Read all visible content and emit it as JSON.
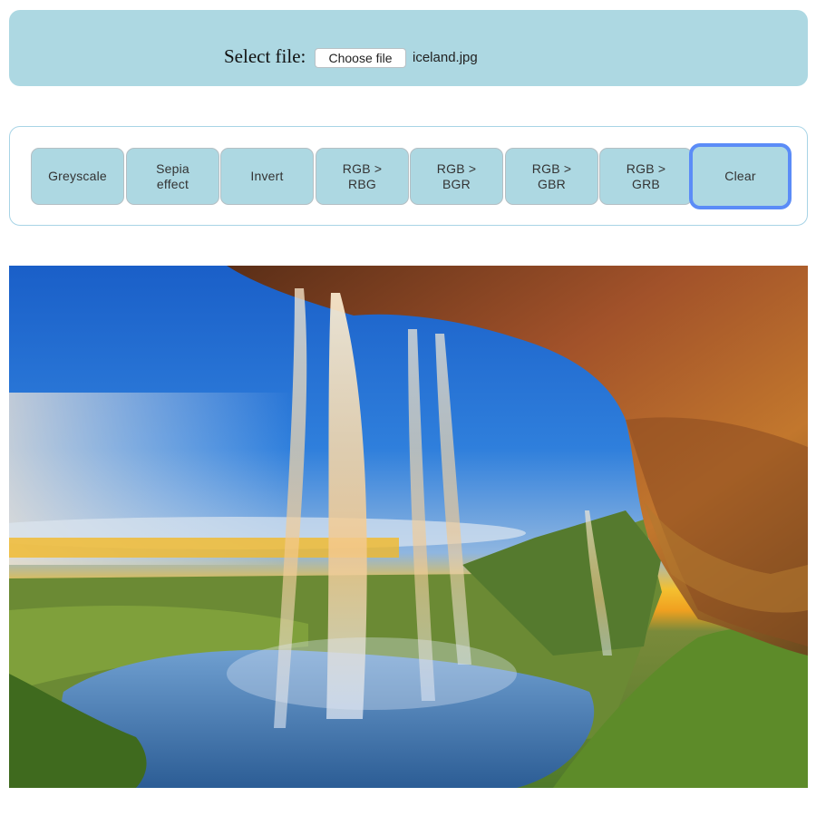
{
  "file_panel": {
    "label": "Select file:",
    "choose_button": "Choose file",
    "file_name": "iceland.jpg"
  },
  "toolbar": {
    "buttons": [
      {
        "label": "Greyscale"
      },
      {
        "label": "Sepia\neffect"
      },
      {
        "label": "Invert"
      },
      {
        "label": "RGB >\nRBG"
      },
      {
        "label": "RGB >\nBGR"
      },
      {
        "label": "RGB >\nGBR"
      },
      {
        "label": "RGB >\nGRB"
      },
      {
        "label": "Clear"
      }
    ],
    "focused_button": "Clear"
  },
  "image": {
    "subject": "waterfall-cave-landscape"
  },
  "colors": {
    "panel_bg": "#add8e2",
    "button_bg": "#add8e2",
    "focus_ring": "#5b8cf7"
  }
}
